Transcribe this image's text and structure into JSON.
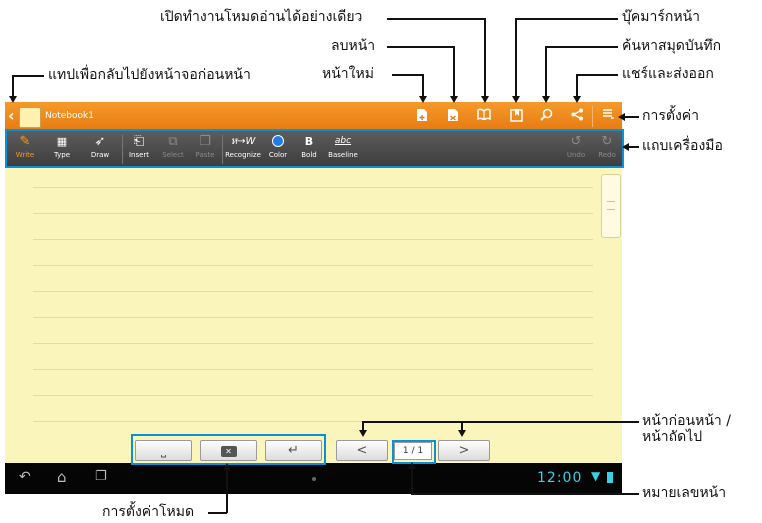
{
  "callouts": {
    "read_only_mode": "เปิดทำงานโหมดอ่านได้อย่างเดียว",
    "bookmark": "บุ๊คมาร์กหน้า",
    "delete_page": "ลบหน้า",
    "search": "ค้นหาสมุดบันทึก",
    "new_page": "หน้าใหม่",
    "share_export": "แชร์และส่งออก",
    "back": "แทปเพื่อกลับไปยังหน้าจอก่อนหน้า",
    "settings": "การตั้งค่า",
    "toolbar": "แถบเครื่องมือ",
    "prev_next_line1": "หน้าก่อนหน้า /",
    "prev_next_line2": "หน้าถัดไป",
    "mode_settings": "การตั้งค่าโหมด",
    "page_number": "หมายเลขหน้า"
  },
  "app": {
    "notebook_title": "Notebook1"
  },
  "toolbar": {
    "write": "Write",
    "type": "Type",
    "draw": "Draw",
    "insert": "Insert",
    "select": "Select",
    "paste": "Paste",
    "recognize": "Recognize",
    "color": "Color",
    "bold": "Bold",
    "baseline": "Baseline",
    "baseline_icon_text": "abc",
    "undo": "Undo",
    "redo": "Redo",
    "recognize_icon_text": "ห→W",
    "bold_icon_text": "B"
  },
  "pager": {
    "prev": "<",
    "next": ">",
    "page_indicator": "1 / 1"
  },
  "statusbar": {
    "time": "12:00"
  },
  "colors": {
    "accent_blue": "#0b8fd8",
    "titlebar_orange": "#f08a1e",
    "page_yellow": "#faf6bb",
    "time_teal": "#3ad0e6"
  }
}
